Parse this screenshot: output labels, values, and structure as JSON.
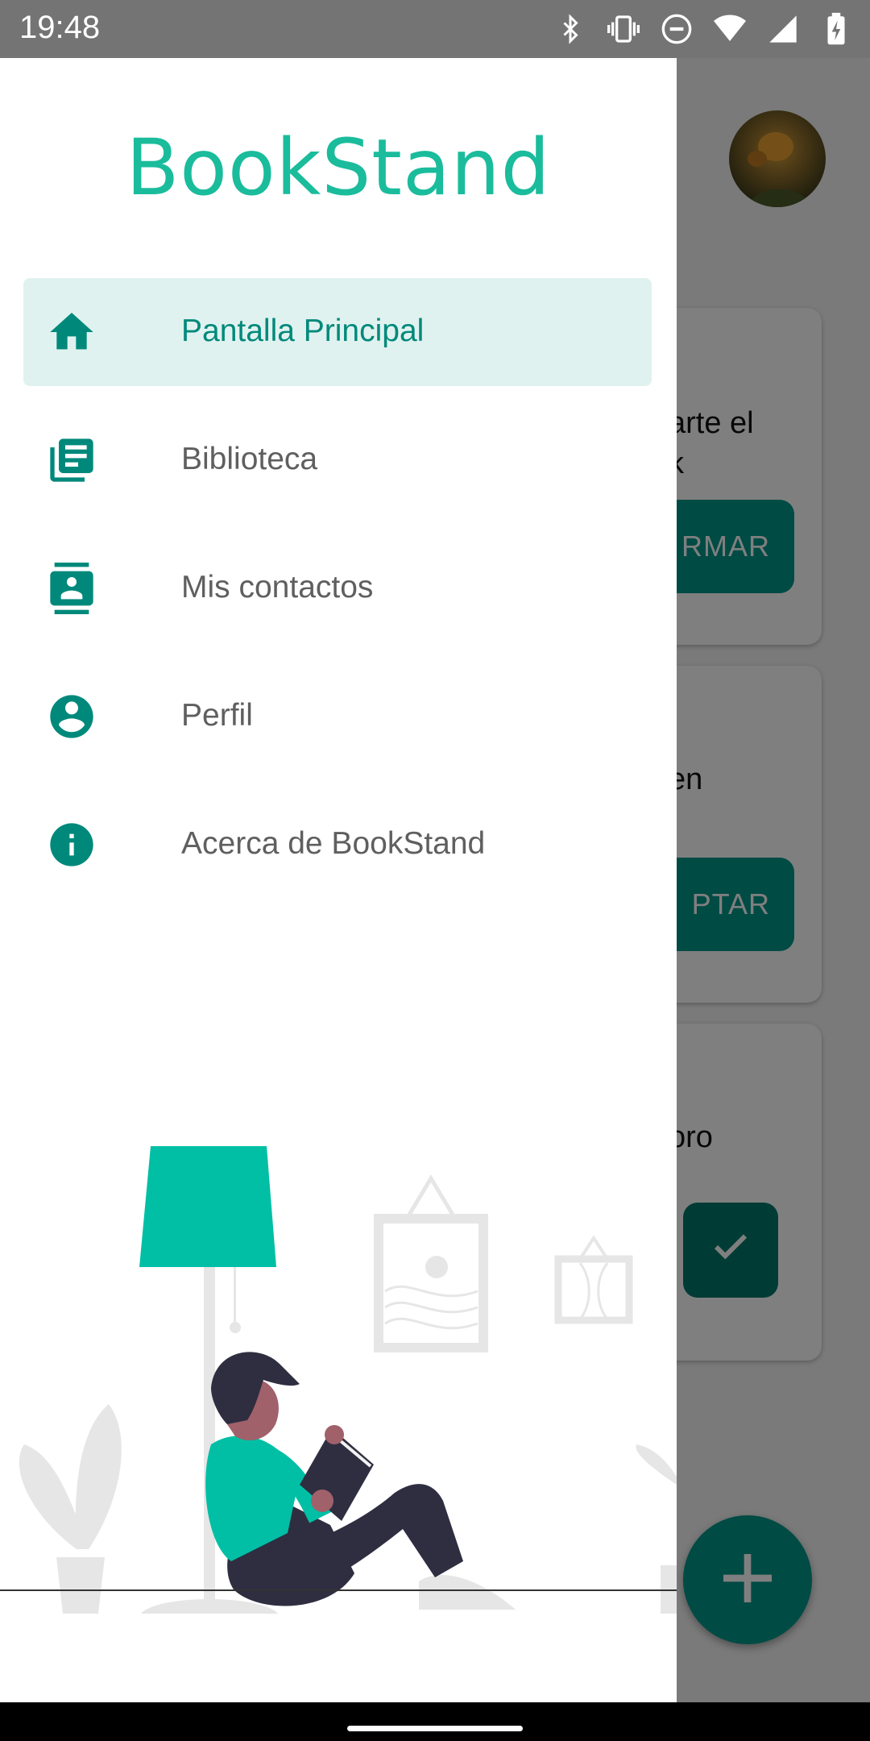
{
  "status_bar": {
    "time": "19:48",
    "icons": [
      "bluetooth-icon",
      "vibrate-icon",
      "do-not-disturb-icon",
      "wifi-icon",
      "cell-signal-icon",
      "battery-charging-icon"
    ]
  },
  "drawer": {
    "title": "BookStand",
    "items": [
      {
        "label": "Pantalla Principal",
        "icon": "home-icon",
        "active": true
      },
      {
        "label": "Biblioteca",
        "icon": "library-books-icon",
        "active": false
      },
      {
        "label": "Mis contactos",
        "icon": "contacts-icon",
        "active": false
      },
      {
        "label": "Perfil",
        "icon": "account-circle-icon",
        "active": false
      },
      {
        "label": "Acerca de BookStand",
        "icon": "info-icon",
        "active": false
      }
    ]
  },
  "background_app": {
    "cards": [
      {
        "text_line1": "arte el",
        "text_line2": "k",
        "button": "RMAR"
      },
      {
        "text_line1": "en",
        "button": "PTAR"
      },
      {
        "text_line1": "oro",
        "button_icon": "check-icon"
      }
    ],
    "fab_icon": "add-icon"
  },
  "colors": {
    "accent": "#1abc9c",
    "primary": "#009688",
    "active_bg": "#e0f2ef",
    "icon": "#00897b"
  }
}
